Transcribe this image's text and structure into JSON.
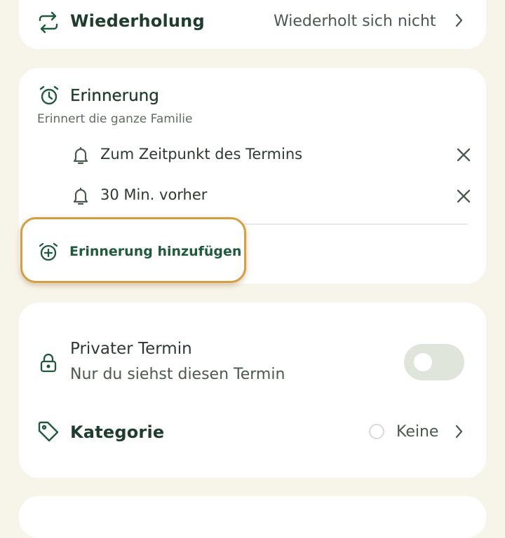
{
  "repeat": {
    "label": "Wiederholung",
    "value": "Wiederholt sich nicht",
    "icon": "repeat-icon"
  },
  "reminder": {
    "title": "Erinnerung",
    "subtitle": "Erinnert die ganze Familie",
    "items": [
      {
        "label": "Zum Zeitpunkt des Termins",
        "icon": "bell-icon"
      },
      {
        "label": "30 Min. vorher",
        "icon": "bell-icon"
      }
    ],
    "add_label": "Erinnerung hinzufügen"
  },
  "privacy": {
    "title": "Privater Termin",
    "subtitle": "Nur du siehst diesen Termin",
    "enabled": false
  },
  "category": {
    "label": "Kategorie",
    "value": "Keine"
  },
  "colors": {
    "accent": "#1f5a3b",
    "highlight": "#d39e44",
    "background": "#f7f4ea"
  }
}
